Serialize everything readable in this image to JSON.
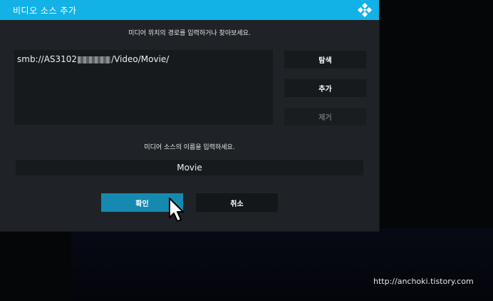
{
  "dialog": {
    "title": "비디오 소스 추가",
    "path_hint": "미디어 위치의 경로를 입력하거나 찾아보세요.",
    "paths": [
      {
        "prefix": "smb://AS3102",
        "suffix": "/Video/Movie/"
      }
    ],
    "buttons": {
      "browse": "탐색",
      "add": "추가",
      "remove": "제거"
    },
    "name_hint": "미디어 소스의 이름을 입력하세요.",
    "source_name": "Movie",
    "actions": {
      "ok": "확인",
      "cancel": "취소"
    }
  },
  "watermark": "http://anchoki.tistory.com",
  "colors": {
    "accent": "#12b2e7",
    "focus": "#1689b0",
    "panel": "#1f2327"
  }
}
